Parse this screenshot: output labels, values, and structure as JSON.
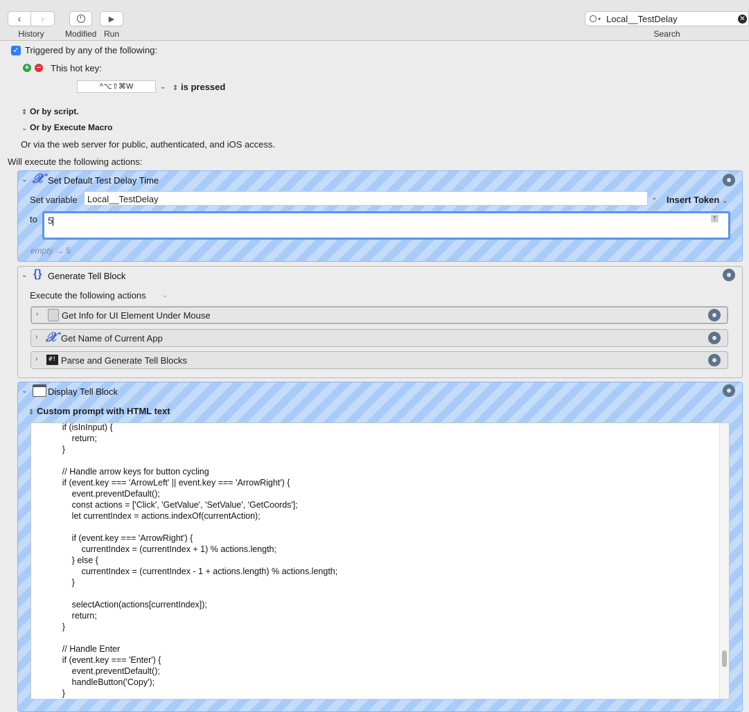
{
  "toolbar": {
    "history_label": "History",
    "modified_label": "Modified",
    "run_label": "Run",
    "search_value": "Local__TestDelay",
    "search_label": "Search"
  },
  "triggers": {
    "triggered_label": "Triggered by any of the following:",
    "hotkey_label": "This hot key:",
    "hotkey_value": "^⌥⇧⌘W",
    "hotkey_state": "is pressed",
    "or_by_script": "Or by script.",
    "or_by_execute_macro": "Or by Execute Macro",
    "web_server_text": "Or via the web server for public, authenticated, and iOS access.",
    "will_execute": "Will execute the following actions:"
  },
  "actions": {
    "set_default": {
      "title": "Set Default Test Delay Time",
      "set_variable_label": "Set variable",
      "variable_name": "Local__TestDelay",
      "insert_token": "Insert Token",
      "to_label": "to",
      "value": "5",
      "token_badge": "T",
      "preview_empty": "empty",
      "preview_value": "5"
    },
    "generate_tell": {
      "title": "Generate Tell Block",
      "execute_label": "Execute the following actions",
      "sub_actions": [
        {
          "label": "Get Info for UI Element Under Mouse"
        },
        {
          "label": "Get Name of Current App"
        },
        {
          "label": "Parse and Generate Tell Blocks"
        }
      ]
    },
    "display_tell": {
      "title": "Display Tell Block",
      "prompt_type": "Custom prompt with HTML text",
      "code_lines": [
        "        if (isInInput) {",
        "            return;",
        "        }",
        "",
        "        // Handle arrow keys for button cycling",
        "        if (event.key === 'ArrowLeft' || event.key === 'ArrowRight') {",
        "            event.preventDefault();",
        "            const actions = ['Click', 'GetValue', 'SetValue', 'GetCoords'];",
        "            let currentIndex = actions.indexOf(currentAction);",
        "",
        "            if (event.key === 'ArrowRight') {",
        "                currentIndex = (currentIndex + 1) % actions.length;",
        "            } else {",
        "                currentIndex = (currentIndex - 1 + actions.length) % actions.length;",
        "            }",
        "",
        "            selectAction(actions[currentIndex]);",
        "            return;",
        "        }",
        "",
        "        // Handle Enter",
        "        if (event.key === 'Enter') {",
        "            event.preventDefault();",
        "            handleButton('Copy');",
        "        }"
      ]
    }
  }
}
